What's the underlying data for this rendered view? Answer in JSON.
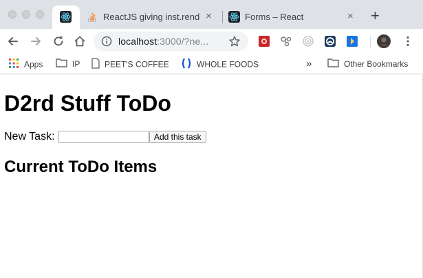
{
  "browser": {
    "tabs": [
      {
        "title": "",
        "icon": "react-icon",
        "active": true
      },
      {
        "title": "ReactJS giving inst.render is not",
        "icon": "stack-overflow-icon",
        "active": false
      },
      {
        "title": "Forms – React",
        "icon": "react-icon",
        "active": false
      }
    ],
    "close_glyph": "×",
    "new_tab_glyph": "+",
    "address": {
      "host": "localhost",
      "rest": ":3000/?ne..."
    },
    "bookmarks": [
      {
        "label": "Apps",
        "icon": "apps-grid-icon"
      },
      {
        "label": "IP",
        "icon": "folder-icon"
      },
      {
        "label": "PEET'S COFFEE",
        "icon": "page-icon"
      },
      {
        "label": "WHOLE FOODS",
        "icon": "whole-foods-icon"
      }
    ],
    "overflow_glyph": "»",
    "other_bookmarks": "Other Bookmarks",
    "accent": "#1a73e8"
  },
  "app": {
    "title": "D2rd Stuff ToDo",
    "new_task_label": "New Task:",
    "new_task_value": "",
    "add_button": "Add this task",
    "list_title": "Current ToDo Items",
    "items": []
  }
}
